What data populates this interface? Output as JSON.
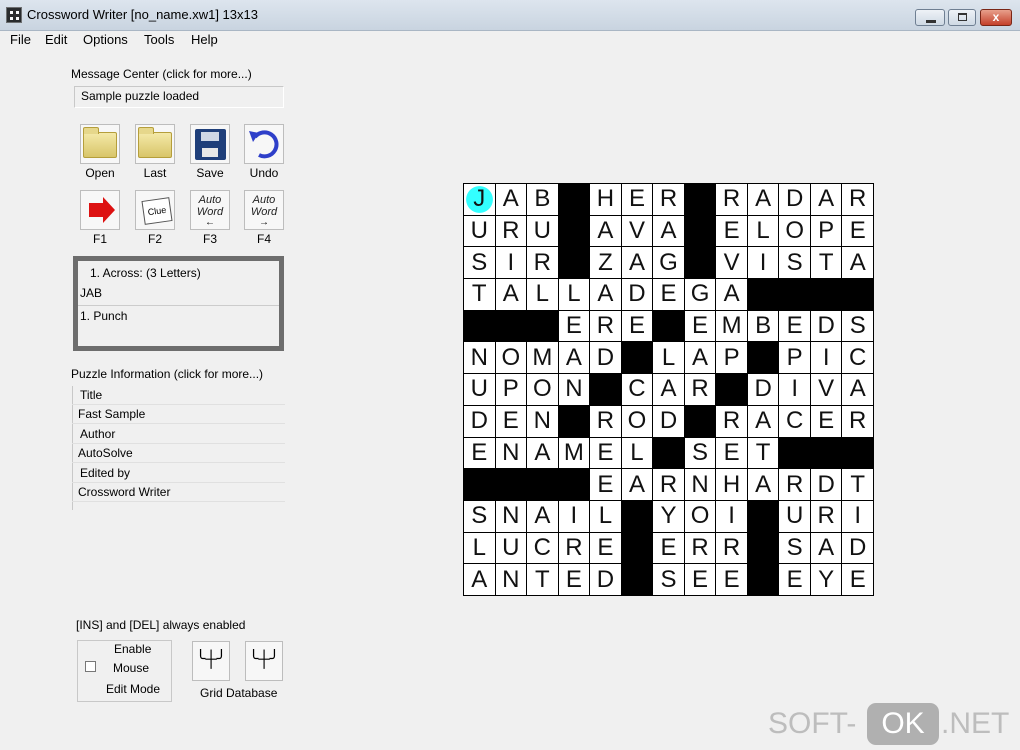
{
  "window": {
    "title": "Crossword Writer  [no_name.xw1]  13x13",
    "min_glyph": "",
    "max_glyph": "",
    "close_glyph": "x"
  },
  "menu": [
    "File",
    "Edit",
    "Options",
    "Tools",
    "Help"
  ],
  "message_center": {
    "label": "Message Center (click for more...)",
    "value": "Sample puzzle loaded"
  },
  "toolbar_row1": [
    {
      "label": "Open",
      "icon": "folder-open-icon"
    },
    {
      "label": "Last",
      "icon": "folder-last-icon"
    },
    {
      "label": "Save",
      "icon": "save-disk-icon"
    },
    {
      "label": "Undo",
      "icon": "undo-arrow-icon"
    }
  ],
  "toolbar_row2": [
    {
      "label": "F1",
      "icon": "red-arrow-icon"
    },
    {
      "label": "F2",
      "icon": "clue-card-icon",
      "text": "Clue"
    },
    {
      "label": "F3",
      "icon": "autoword-left-icon",
      "text": "Auto Word",
      "arrow": "←"
    },
    {
      "label": "F4",
      "icon": "autoword-right-icon",
      "text": "Auto Word",
      "arrow": "→"
    }
  ],
  "clue_panel": {
    "header": "1.  Across:  (3 Letters)",
    "answer": "JAB",
    "clue": "1. Punch"
  },
  "puzzle_info": {
    "label": "Puzzle Information (click for more...)",
    "rows": [
      "Title",
      "Fast Sample",
      "Author",
      "AutoSolve",
      "Edited by",
      "Crossword Writer"
    ]
  },
  "grid": {
    "size": 13,
    "rows": [
      "JAB#HER#RADAR",
      "URU#AVA#ELOPE",
      "SIR#ZAG#VISTA",
      "TALLADEGA####",
      "###ERE#EMBEDS",
      "NOMAD#LAP#PIC",
      "UPON#CAR#DIVA",
      "DEN#ROD#RACER",
      "ENAMEL#SET###",
      "####EARNHARDT",
      "SNAIL#YOI#URI",
      "LUCRE#ERR#SAD",
      "ANTED#SEE#EYE"
    ],
    "cursor": {
      "row": 0,
      "col": 0
    }
  },
  "insdel_note": "[INS] and [DEL] always enabled",
  "mouse_edit": {
    "line1": "Enable",
    "line2": "Mouse",
    "line3": "Edit Mode",
    "checked": false
  },
  "grid_database": {
    "label": "Grid Database",
    "btn1": "╰┼╯",
    "btn2": "╰┼╯"
  },
  "watermark": {
    "left": "SOFT-",
    "ok": "OK",
    "right": ".NET"
  }
}
